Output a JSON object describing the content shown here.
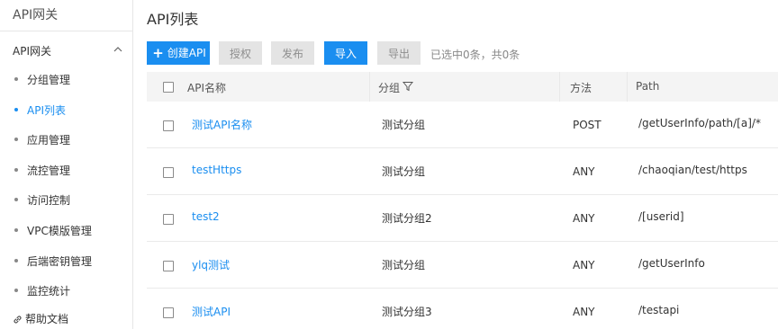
{
  "sidebar": {
    "brand": "API网关",
    "group": {
      "title": "API网关"
    },
    "items": [
      {
        "label": "分组管理"
      },
      {
        "label": "API列表",
        "active": true
      },
      {
        "label": "应用管理"
      },
      {
        "label": "流控管理"
      },
      {
        "label": "访问控制"
      },
      {
        "label": "VPC模版管理"
      },
      {
        "label": "后端密钥管理"
      },
      {
        "label": "监控统计"
      }
    ],
    "help": {
      "label": "帮助文档",
      "icon": "link-icon"
    }
  },
  "main": {
    "title": "API列表",
    "toolbar": {
      "create": "创建API",
      "authorize": "授权",
      "publish": "发布",
      "import": "导入",
      "export": "导出",
      "selection_info": "已选中0条，共0条"
    },
    "table": {
      "headers": {
        "name": "API名称",
        "group": "分组",
        "method": "方法",
        "path": "Path"
      },
      "rows": [
        {
          "name": "测试API名称",
          "group": "测试分组",
          "method": "POST",
          "path": "/getUserInfo/path/[a]/*"
        },
        {
          "name": "testHttps",
          "group": "测试分组",
          "method": "ANY",
          "path": "/chaoqian/test/https"
        },
        {
          "name": "test2",
          "group": "测试分组2",
          "method": "ANY",
          "path": "/[userid]"
        },
        {
          "name": "ylq测试",
          "group": "测试分组",
          "method": "ANY",
          "path": "/getUserInfo"
        },
        {
          "name": "测试API",
          "group": "测试分组3",
          "method": "ANY",
          "path": "/testapi"
        }
      ]
    }
  },
  "colors": {
    "accent": "#1a8ef0",
    "disabled_bg": "#e4e4e4",
    "header_bg": "#f4f4f4"
  }
}
